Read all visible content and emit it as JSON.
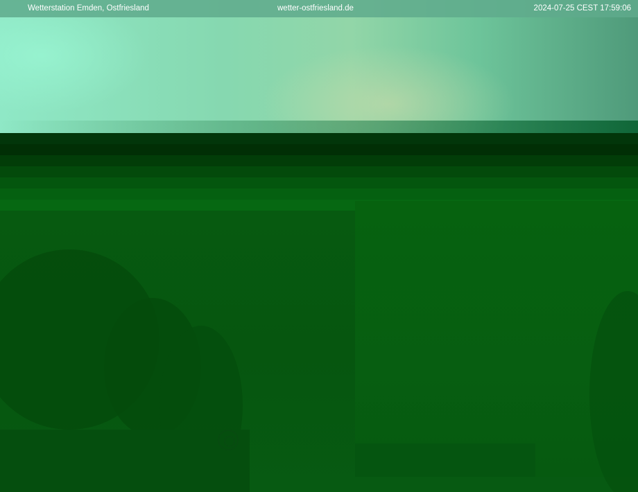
{
  "header": {
    "station_name": "Wetterstation Emden, Ostfriesland",
    "website": "wetter-ostfriesland.de",
    "timestamp": "2024-07-25 CEST 17:59:06"
  },
  "colors": {
    "header_bg": "#5faa8c",
    "header_text": "#ffffff",
    "sky_light": "#8fe8c6",
    "ground_dark": "#075a10"
  },
  "icons": {
    "watermark": "camera-logo-icon"
  }
}
